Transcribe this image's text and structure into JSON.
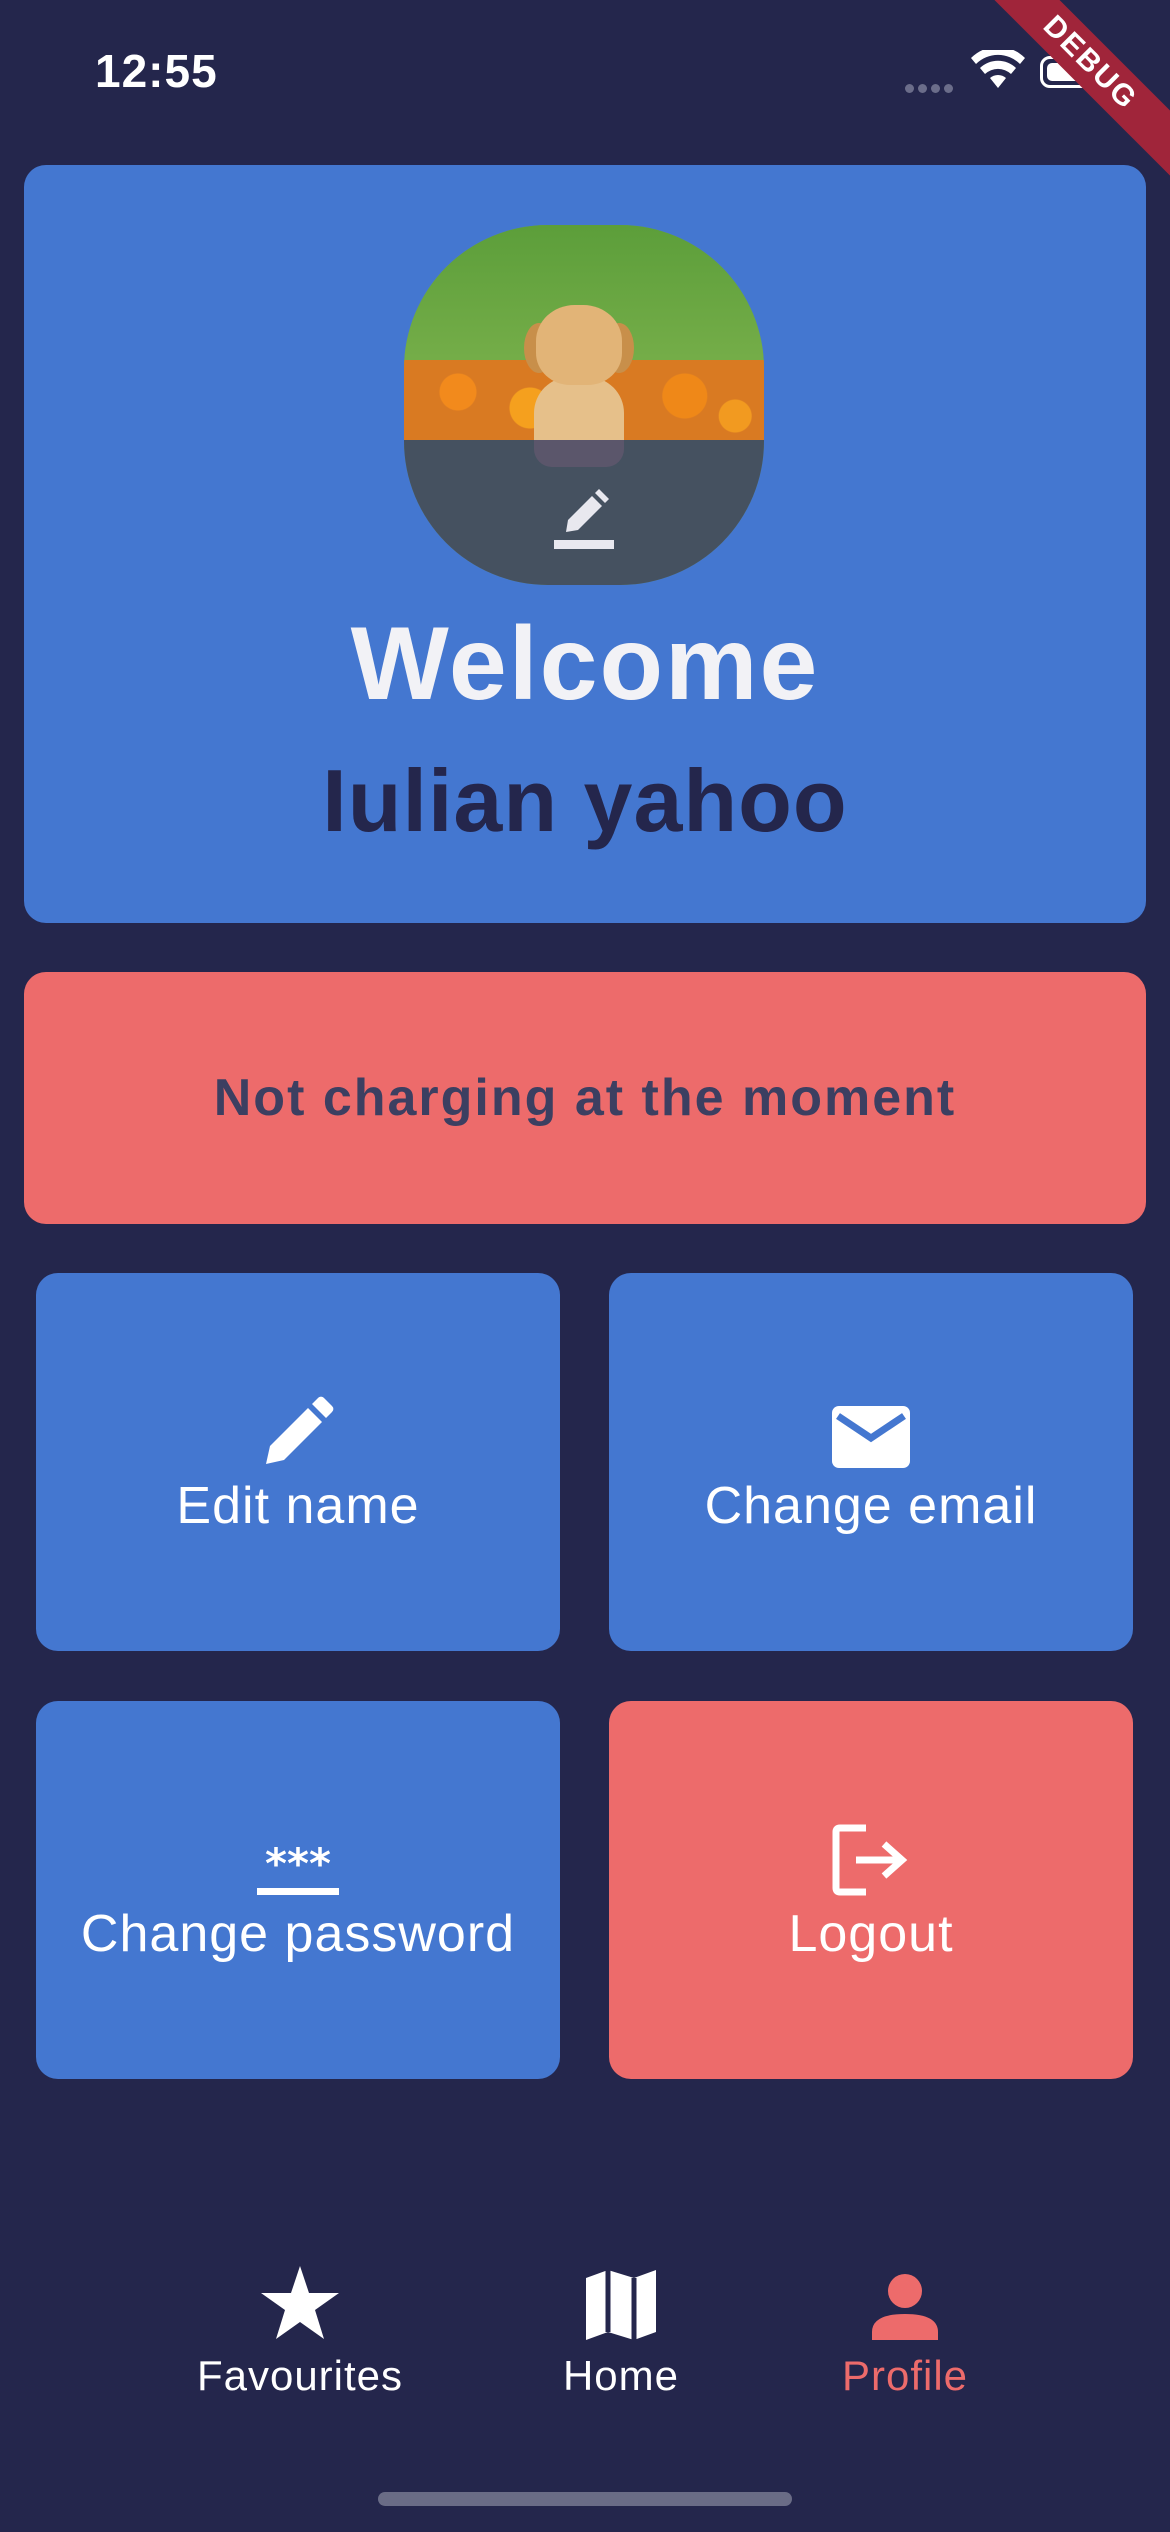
{
  "status_bar": {
    "time": "12:55",
    "debug_label": "DEBUG"
  },
  "profile": {
    "welcome": "Welcome",
    "user_name": "Iulian yahoo"
  },
  "status_banner": {
    "text": "Not charging at the moment"
  },
  "actions": {
    "edit_name": {
      "label": "Edit name",
      "icon": "pencil-icon"
    },
    "change_email": {
      "label": "Change email",
      "icon": "mail-icon"
    },
    "change_password": {
      "label": "Change password",
      "icon": "password-icon"
    },
    "logout": {
      "label": "Logout",
      "icon": "logout-icon"
    }
  },
  "nav": {
    "items": [
      {
        "label": "Favourites",
        "icon": "star-icon",
        "active": false
      },
      {
        "label": "Home",
        "icon": "map-icon",
        "active": false
      },
      {
        "label": "Profile",
        "icon": "person-icon",
        "active": true
      }
    ]
  },
  "colors": {
    "background": "#24264c",
    "primary": "#4477d0",
    "accent": "#ed6b6b",
    "text_dark": "#24264c"
  }
}
